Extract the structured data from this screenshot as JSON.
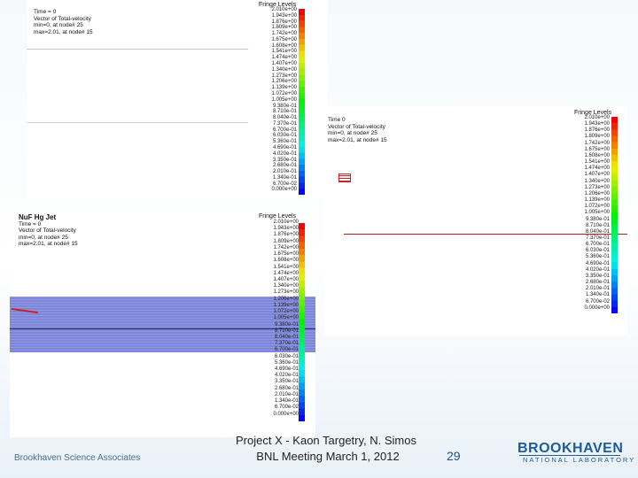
{
  "panel_top": {
    "header": [
      "Time =        0",
      "Vector of Total-velocity",
      "min=0, at node# 25",
      "max=2.01, at node# 15"
    ],
    "fringe_title": "Fringe Levels",
    "levels": [
      "2.010e+00",
      "1.943e+00",
      "1.876e+00",
      "1.809e+00",
      "1.742e+00",
      "1.675e+00",
      "1.608e+00",
      "1.541e+00",
      "1.474e+00",
      "1.407e+00",
      "1.340e+00",
      "1.273e+00",
      "1.206e+00",
      "1.139e+00",
      "1.072e+00",
      "1.005e+00",
      "9.380e-01",
      "8.710e-01",
      "8.040e-01",
      "7.370e-01",
      "6.700e-01",
      "6.030e-01",
      "5.360e-01",
      "4.690e-01",
      "4.020e-01",
      "3.350e-01",
      "2.680e-01",
      "2.010e-01",
      "1.340e-01",
      "6.700e-02",
      "0.000e+00"
    ]
  },
  "panel_right": {
    "header": [
      "Time          0",
      "Vector of Total-velocity",
      "min=0, at node# 25",
      "max=2.01, at node# 15"
    ],
    "fringe_title": "Fringe Levels",
    "levels": [
      "2.010e+00",
      "1.943e+00",
      "1.876e+00",
      "1.809e+00",
      "1.742e+00",
      "1.675e+00",
      "1.608e+00",
      "1.541e+00",
      "1.474e+00",
      "1.407e+00",
      "1.340e+00",
      "1.273e+00",
      "1.206e+00",
      "1.139e+00",
      "1.072e+00",
      "1.005e+00",
      "9.380e-01",
      "8.710e-01",
      "8.040e-01",
      "7.370e-01",
      "6.700e-01",
      "6.030e-01",
      "5.360e-01",
      "4.690e-01",
      "4.020e-01",
      "3.350e-01",
      "2.680e-01",
      "2.010e-01",
      "1.340e-01",
      "6.700e-02",
      "0.000e+00"
    ]
  },
  "panel_bottom": {
    "title": "NuF Hg Jet",
    "header": [
      "Time =        0",
      "Vector of Total-velocity",
      "min=0, at node# 25",
      "max=2.01, at node# 15"
    ],
    "fringe_title": "Fringe Levels",
    "levels": [
      "2.010e+00",
      "1.943e+00",
      "1.876e+00",
      "1.809e+00",
      "1.742e+00",
      "1.675e+00",
      "1.608e+00",
      "1.541e+00",
      "1.474e+00",
      "1.407e+00",
      "1.340e+00",
      "1.273e+00",
      "1.206e+00",
      "1.139e+00",
      "1.072e+00",
      "1.005e+00",
      "9.380e-01",
      "8.710e-01",
      "8.040e-01",
      "7.370e-01",
      "6.700e-01",
      "6.030e-01",
      "5.360e-01",
      "4.690e-01",
      "4.020e-01",
      "3.350e-01",
      "2.680e-01",
      "2.010e-01",
      "1.340e-01",
      "6.700e-02",
      "0.000e+00"
    ]
  },
  "footer": {
    "line1": "Project X - Kaon Targetry, N. Simos",
    "line2": "BNL Meeting March 1, 2012",
    "page_number": "29",
    "left_brand": "Brookhaven Science Associates",
    "logo_word": "BROOKHAVEN",
    "logo_sub": "NATIONAL LABORATORY"
  },
  "colors": {
    "jet_fill": "#7d86d8",
    "trajectory": "#cc2222",
    "logo_blue": "#1b5c9e"
  }
}
